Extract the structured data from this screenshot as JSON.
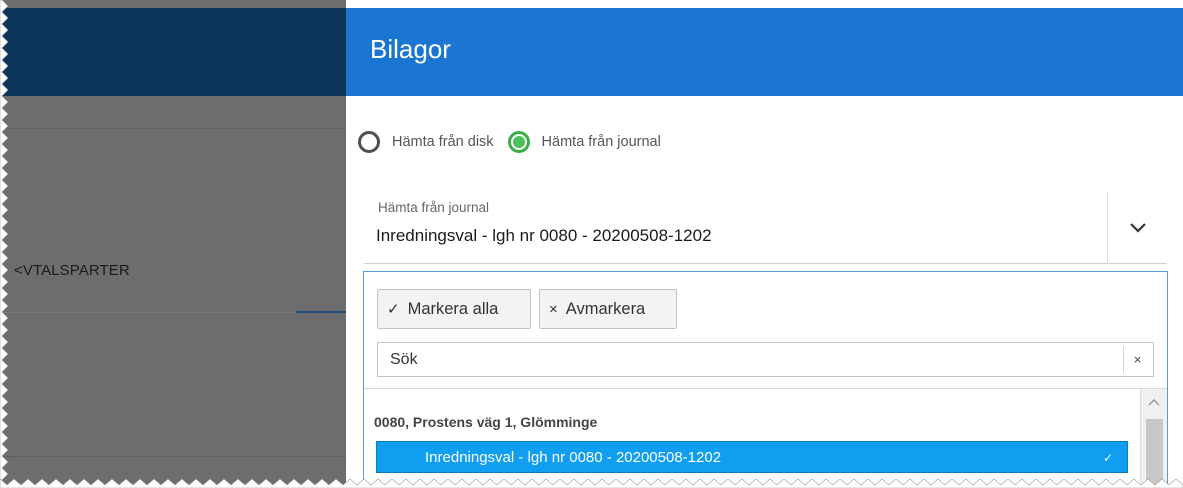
{
  "background_app": {
    "section_label": "<VTALSPARTER"
  },
  "dialog": {
    "title": "Bilagor",
    "source_options": [
      {
        "label": "Hämta från disk",
        "checked": false
      },
      {
        "label": "Hämta från journal",
        "checked": true
      }
    ],
    "journal_select": {
      "caption": "Hämta från journal",
      "value": "Inredningsval - lgh nr 0080 - 20200508-1202",
      "arrow_icon": "chevron-down-icon"
    },
    "dropdown": {
      "select_all_label": "Markera alla",
      "select_all_glyph": "✓",
      "deselect_label": "Avmarkera",
      "deselect_glyph": "×",
      "search_placeholder": "Sök",
      "search_clear_glyph": "×",
      "groups": [
        {
          "header": "0080, Prostens väg 1, Glömminge",
          "items": [
            {
              "label": "Inredningsval - lgh nr 0080 - 20200508-1202",
              "selected": true,
              "check_glyph": "✓"
            }
          ]
        }
      ]
    }
  },
  "colors": {
    "header_blue": "#1a76d2",
    "bg_header_navy": "#0c3559",
    "overlay_gray": "#6d6d6d",
    "radio_checked_green": "#4cc05a",
    "selected_item_blue": "#0f9ef0",
    "dropdown_border": "#5a9bd5"
  }
}
